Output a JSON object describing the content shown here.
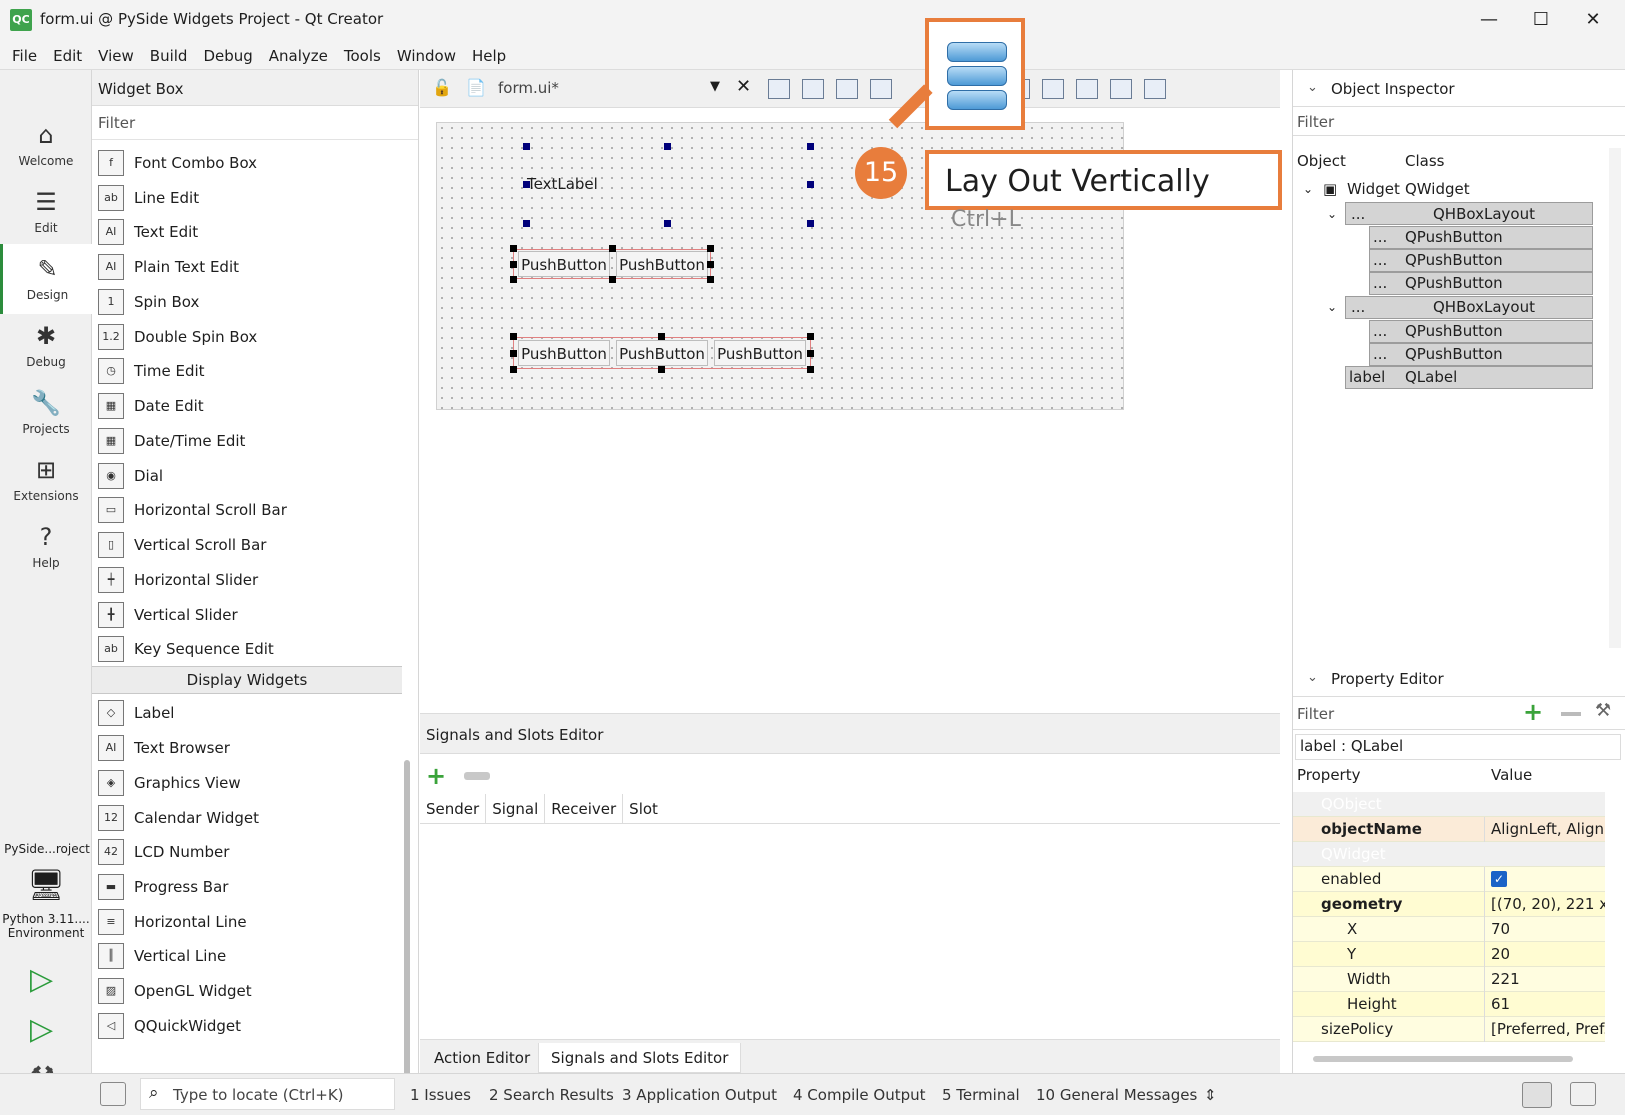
{
  "window": {
    "logo": "QC",
    "title": "form.ui @ PySide Widgets Project - Qt Creator",
    "minimize": "—",
    "maximize": "☐",
    "close": "✕"
  },
  "menu": [
    "File",
    "Edit",
    "View",
    "Build",
    "Debug",
    "Analyze",
    "Tools",
    "Window",
    "Help"
  ],
  "modes": [
    {
      "label": "Welcome",
      "icon": "home-icon"
    },
    {
      "label": "Edit",
      "icon": "edit-lines-icon"
    },
    {
      "label": "Design",
      "icon": "pen-icon"
    },
    {
      "label": "Debug",
      "icon": "bug-icon"
    },
    {
      "label": "Projects",
      "icon": "wrench-icon"
    },
    {
      "label": "Extensions",
      "icon": "extensions-icon"
    },
    {
      "label": "Help",
      "icon": "help-icon"
    }
  ],
  "kit": {
    "project": "PySide...roject",
    "env": "Python 3.11.... Environment"
  },
  "widget_box": {
    "title": "Widget Box",
    "filter": "Filter",
    "items": [
      "Font Combo Box",
      "Line Edit",
      "Text Edit",
      "Plain Text Edit",
      "Spin Box",
      "Double Spin Box",
      "Time Edit",
      "Date Edit",
      "Date/Time Edit",
      "Dial",
      "Horizontal Scroll Bar",
      "Vertical Scroll Bar",
      "Horizontal Slider",
      "Vertical Slider",
      "Key Sequence Edit"
    ],
    "category": "Display Widgets",
    "display_items": [
      "Label",
      "Text Browser",
      "Graphics View",
      "Calendar Widget",
      "LCD Number",
      "Progress Bar",
      "Horizontal Line",
      "Vertical Line",
      "OpenGL Widget",
      "QQuickWidget"
    ]
  },
  "editor": {
    "file": "form.ui*"
  },
  "form": {
    "label": "TextLabel",
    "row1": [
      "PushButton",
      "PushButton"
    ],
    "row2": [
      "PushButton",
      "PushButton",
      "PushButton"
    ]
  },
  "signals": {
    "title": "Signals and Slots Editor",
    "columns": [
      "Sender",
      "Signal",
      "Receiver",
      "Slot"
    ],
    "tabs": [
      "Action Editor",
      "Signals and Slots Editor"
    ]
  },
  "object_inspector": {
    "title": "Object Inspector",
    "filter": "Filter",
    "col_object": "Object",
    "col_class": "Class",
    "rows": [
      {
        "object": "Widget",
        "class": "QWidget"
      },
      {
        "object": "...",
        "class": "QHBoxLayout"
      },
      {
        "object": "...",
        "class": "QPushButton"
      },
      {
        "object": "...",
        "class": "QPushButton"
      },
      {
        "object": "...",
        "class": "QPushButton"
      },
      {
        "object": "...",
        "class": "QHBoxLayout"
      },
      {
        "object": "...",
        "class": "QPushButton"
      },
      {
        "object": "...",
        "class": "QPushButton"
      },
      {
        "object": "label",
        "class": "QLabel"
      }
    ]
  },
  "property_editor": {
    "title": "Property Editor",
    "filter": "Filter",
    "context": "label : QLabel",
    "col_property": "Property",
    "col_value": "Value",
    "group_qobject": "QObject",
    "group_qwidget": "QWidget",
    "rows": [
      {
        "key": "objectName",
        "value": "AlignLeft, Align."
      },
      {
        "key": "enabled",
        "value": "✓"
      },
      {
        "key": "geometry",
        "value": "[(70, 20), 221 x 61]"
      },
      {
        "key": "X",
        "value": "70"
      },
      {
        "key": "Y",
        "value": "20"
      },
      {
        "key": "Width",
        "value": "221"
      },
      {
        "key": "Height",
        "value": "61"
      },
      {
        "key": "sizePolicy",
        "value": "[Preferred, Pref..."
      }
    ]
  },
  "statusbar": {
    "locate": "Type to locate (Ctrl+K)",
    "items": [
      "1  Issues",
      "2  Search Results",
      "3  Application Output",
      "4  Compile Output",
      "5  Terminal",
      "10  General Messages"
    ]
  },
  "callout": {
    "number": "15",
    "tooltip": "Lay Out Vertically",
    "shortcut": "Ctrl+L"
  },
  "colors": {
    "accent": "#e87d3c",
    "qt_green": "#3fa34d",
    "selection": "#d4d4d4"
  }
}
